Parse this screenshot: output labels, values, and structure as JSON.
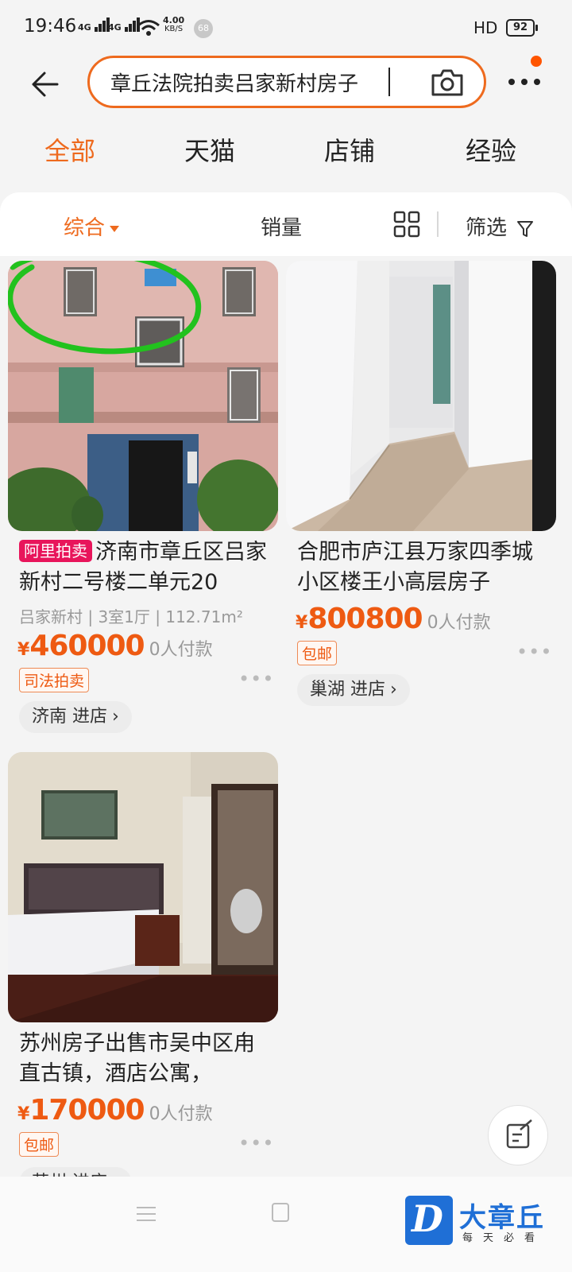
{
  "status_bar": {
    "time": "19:46",
    "signal1": "4G",
    "signal2": "4G",
    "speed_value": "4.00",
    "speed_unit": "KB/S",
    "notification_count": "68",
    "hd": "HD",
    "battery": "92"
  },
  "search": {
    "query": "章丘法院拍卖吕家新村房子"
  },
  "tabs": [
    "全部",
    "天猫",
    "店铺",
    "经验"
  ],
  "sort_bar": {
    "comprehensive": "综合",
    "sales": "销量",
    "filter": "筛选"
  },
  "products": [
    {
      "tag": "阿里拍卖",
      "title": "济南市章丘区吕家新村二号楼二单元20",
      "meta": "吕家新村 | 3室1厅 | 112.71m²",
      "currency": "¥",
      "price": "460000",
      "paid": "0人付款",
      "badge": "司法拍卖",
      "store": "济南 进店"
    },
    {
      "title": "合肥市庐江县万家四季城小区楼王小高层房子",
      "currency": "¥",
      "price": "800800",
      "paid": "0人付款",
      "badge": "包邮",
      "store": "巢湖 进店"
    },
    {
      "title": "苏州房子出售市吴中区甪直古镇，酒店公寓，",
      "currency": "¥",
      "price": "170000",
      "paid": "0人付款",
      "badge": "包邮",
      "store": "苏州 进店"
    }
  ],
  "more_dots": "•••",
  "watermark": {
    "letter": "D",
    "name": "大章丘",
    "slogan": "每天必看"
  },
  "colors": {
    "accent": "#ee6a1e",
    "price": "#ee5a12",
    "ali_tag": "#e8155b",
    "annotation": "#22c21e",
    "logo_blue": "#1f6fd6"
  }
}
